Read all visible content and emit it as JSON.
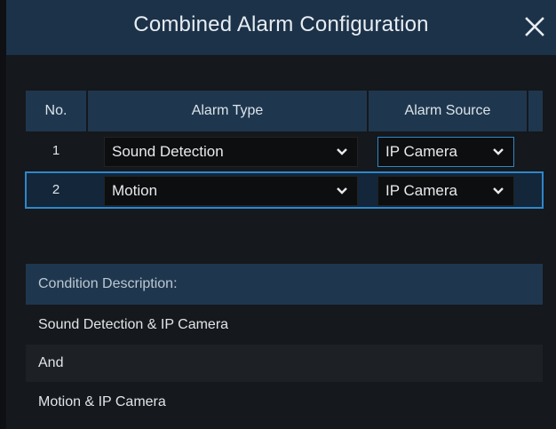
{
  "dialog": {
    "title": "Combined Alarm Configuration",
    "close_glyph": "close-icon"
  },
  "table": {
    "headers": [
      "No.",
      "Alarm Type",
      "Alarm Source"
    ],
    "rows": [
      {
        "no": "1",
        "alarm_type": "Sound Detection",
        "alarm_source": "IP Camera",
        "selected": false
      },
      {
        "no": "2",
        "alarm_type": "Motion",
        "alarm_source": "IP Camera",
        "selected": true
      }
    ]
  },
  "condition": {
    "label": "Condition Description:",
    "lines": [
      "Sound Detection & IP Camera",
      "And",
      "Motion & IP Camera"
    ]
  },
  "colors": {
    "titlebar": "#1c3249",
    "header": "#1f374e",
    "accent": "#2f87c9",
    "background": "#15181c"
  }
}
